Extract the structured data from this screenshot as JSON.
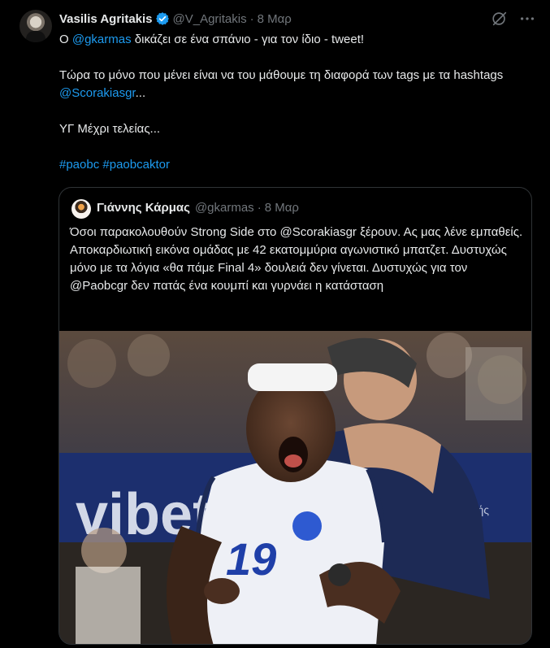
{
  "tweet": {
    "author": {
      "name": "Vasilis Agritakis",
      "handle": "@V_Agritakis",
      "verified": true
    },
    "separator": "·",
    "time": "8 Μαρ",
    "text": {
      "line1_prefix": "Ο ",
      "line1_mention": "@gkarmas",
      "line1_suffix": " δικάζει σε ένα σπάνιο - για τον ίδιο - tweet!",
      "line2_text": "Τώρα το μόνο που μένει είναι να του μάθουμε τη διαφορά των tags με τα hashtags ",
      "line2_mention": "@Scorakiasgr",
      "line2_suffix": "...",
      "line3": "ΥΓ Μέχρι τελείας...",
      "hashtag1": "#paobc",
      "hashtag2": "#paobcaktor"
    },
    "icons": {
      "grok": "grok-icon",
      "more": "more-icon",
      "verified": "verified-badge-icon"
    }
  },
  "quoted_tweet": {
    "author": {
      "name": "Γιάννης Κάρμας",
      "handle": "@gkarmas"
    },
    "separator": "·",
    "time": "8 Μαρ",
    "text": "Όσοι παρακολουθούν Strong Side στο @Scorakiasgr ξέρουν. Ας μας λένε εμπαθείς. Αποκαρδιωτική εικόνα ομάδας με 42 εκατομμύρια αγωνιστικό μπατζετ. Δυστυχώς μόνο με τα λόγια «θα πάμε Final 4» δουλειά δεν γίνεται. Δυστυχώς για τον @Paobcgr δεν πατάς ένα κουμπί και γυρνάει η κατάσταση",
    "image": {
      "jersey_number": "19",
      "banner_text_left": "vibet",
      "banner_text_right": "ακροατής"
    }
  },
  "colors": {
    "background": "#000000",
    "text": "#e7e9ea",
    "secondary": "#71767b",
    "link": "#1d9bf0",
    "border": "#2f3336"
  }
}
